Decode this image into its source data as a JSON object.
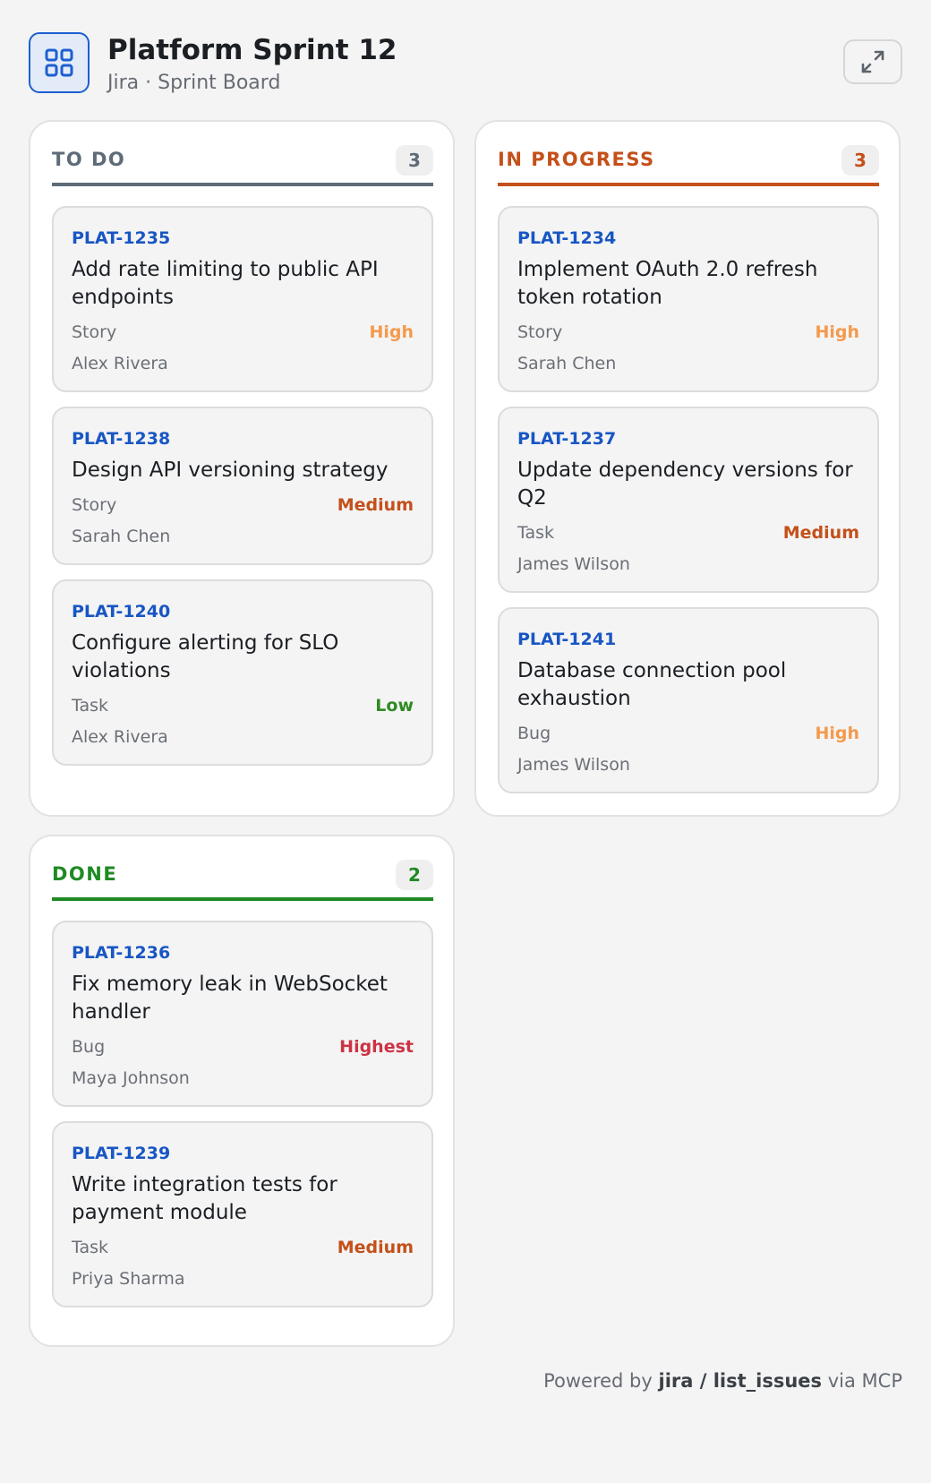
{
  "header": {
    "title": "Platform Sprint 12",
    "subtitle": "Jira · Sprint Board"
  },
  "colors": {
    "todo": "#5e6b78",
    "in_progress": "#c4501a",
    "done": "#1f8a24",
    "priority_high": "#f39a4e",
    "priority_medium": "#c4501a",
    "priority_low": "#2e8b23",
    "priority_highest": "#cc3344",
    "key": "#1856c4"
  },
  "columns": [
    {
      "name": "TO DO",
      "count": "3",
      "color": "#5e6b78",
      "cards": [
        {
          "key": "PLAT-1235",
          "title": "Add rate limiting to public API endpoints",
          "type": "Story",
          "priority": "High",
          "priority_color": "#f39a4e",
          "assignee": "Alex Rivera"
        },
        {
          "key": "PLAT-1238",
          "title": "Design API versioning strategy",
          "type": "Story",
          "priority": "Medium",
          "priority_color": "#c4501a",
          "assignee": "Sarah Chen"
        },
        {
          "key": "PLAT-1240",
          "title": "Configure alerting for SLO violations",
          "type": "Task",
          "priority": "Low",
          "priority_color": "#2e8b23",
          "assignee": "Alex Rivera"
        }
      ]
    },
    {
      "name": "IN PROGRESS",
      "count": "3",
      "color": "#c4501a",
      "cards": [
        {
          "key": "PLAT-1234",
          "title": "Implement OAuth 2.0 refresh token rotation",
          "type": "Story",
          "priority": "High",
          "priority_color": "#f39a4e",
          "assignee": "Sarah Chen"
        },
        {
          "key": "PLAT-1237",
          "title": "Update dependency versions for Q2",
          "type": "Task",
          "priority": "Medium",
          "priority_color": "#c4501a",
          "assignee": "James Wilson"
        },
        {
          "key": "PLAT-1241",
          "title": "Database connection pool exhaustion",
          "type": "Bug",
          "priority": "High",
          "priority_color": "#f39a4e",
          "assignee": "James Wilson"
        }
      ]
    },
    {
      "name": "DONE",
      "count": "2",
      "color": "#1f8a24",
      "cards": [
        {
          "key": "PLAT-1236",
          "title": "Fix memory leak in WebSocket handler",
          "type": "Bug",
          "priority": "Highest",
          "priority_color": "#cc3344",
          "assignee": "Maya Johnson"
        },
        {
          "key": "PLAT-1239",
          "title": "Write integration tests for payment module",
          "type": "Task",
          "priority": "Medium",
          "priority_color": "#c4501a",
          "assignee": "Priya Sharma"
        }
      ]
    }
  ],
  "footer": {
    "prefix": "Powered by",
    "tool": "jira / list_issues",
    "suffix": "via MCP"
  },
  "icons": {
    "logo": "grid-icon",
    "expand": "expand-icon"
  }
}
